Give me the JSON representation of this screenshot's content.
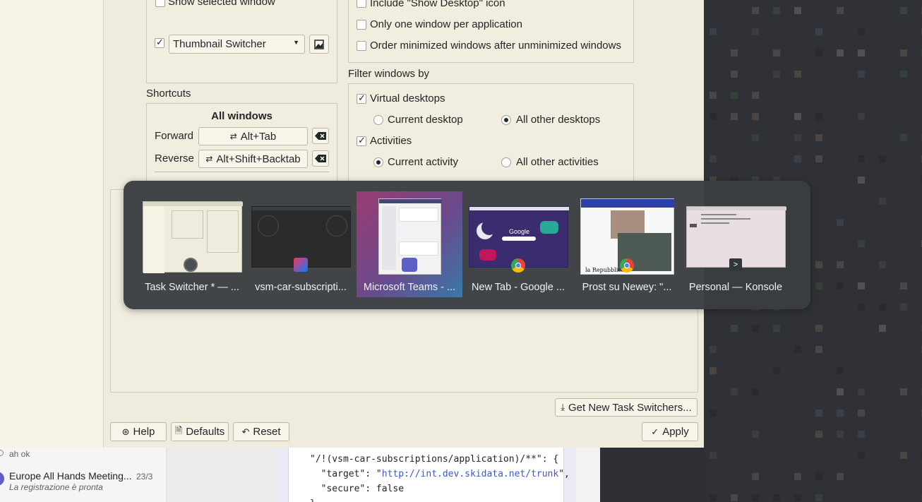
{
  "kcm": {
    "show_selected_window": "Show selected window",
    "thumbnail_switcher_checked": true,
    "switcher_select": "Thumbnail Switcher",
    "include_show_desktop": "Include \"Show Desktop\" icon",
    "one_window_per_app": "Only one window per application",
    "order_minimized": "Order minimized windows after unminimized windows",
    "filter_title": "Filter windows by",
    "virtual_desktops": "Virtual desktops",
    "current_desktop": "Current desktop",
    "all_other_desktops": "All other desktops",
    "activities": "Activities",
    "current_activity": "Current activity",
    "all_other_activities": "All other activities",
    "shortcuts_title": "Shortcuts",
    "all_windows": "All windows",
    "forward_label": "Forward",
    "forward_shortcut": "Alt+Tab",
    "reverse_label": "Reverse",
    "reverse_shortcut": "Alt+Shift+Backtab",
    "get_new": "Get New Task Switchers...",
    "help": "Help",
    "defaults": "Defaults",
    "reset": "Reset",
    "apply": "Apply"
  },
  "switcher": {
    "items": [
      {
        "caption": "Task Switcher * — ..."
      },
      {
        "caption": "vsm-car-subscripti..."
      },
      {
        "caption": "Microsoft Teams - ...",
        "selected": true
      },
      {
        "caption": "New Tab - Google ..."
      },
      {
        "caption": "Prost su Newey: \"..."
      },
      {
        "caption": "Personal — Konsole"
      }
    ],
    "google_logo": "Google",
    "repubblica_logo": "la Repubblica"
  },
  "teams": {
    "prev_msg": "ah ok",
    "chat_title": "Europe All Hands Meeting...",
    "chat_date": "23/3",
    "chat_sub": "La registrazione è pronta"
  },
  "code": {
    "line1": "\"/!(vsm-car-subscriptions/application)/**\": {",
    "line2_key": "  \"target\": \"",
    "line2_url": "http://int.dev.skidata.net/trunk",
    "line2_end": "\",",
    "line3": "  \"secure\": false",
    "line4": "}"
  }
}
